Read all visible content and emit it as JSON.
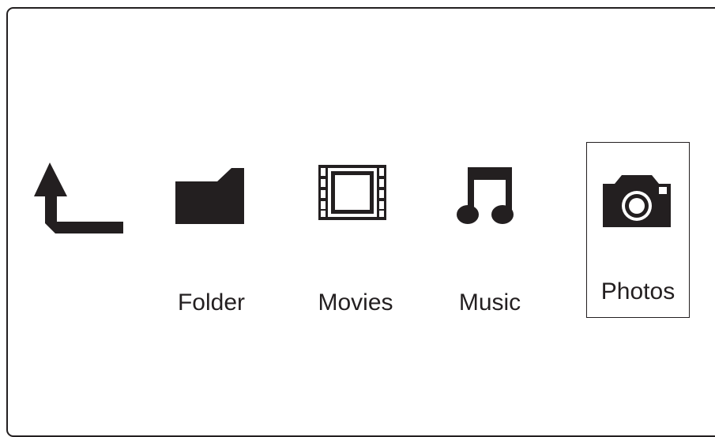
{
  "menu": {
    "items": [
      {
        "id": "back",
        "label": "",
        "icon": "back-arrow-icon"
      },
      {
        "id": "folder",
        "label": "Folder",
        "icon": "folder-icon"
      },
      {
        "id": "movies",
        "label": "Movies",
        "icon": "film-strip-icon"
      },
      {
        "id": "music",
        "label": "Music",
        "icon": "music-note-icon"
      },
      {
        "id": "photos",
        "label": "Photos",
        "icon": "camera-icon",
        "selected": true
      }
    ]
  },
  "colors": {
    "foreground": "#231f20",
    "background": "#ffffff"
  }
}
